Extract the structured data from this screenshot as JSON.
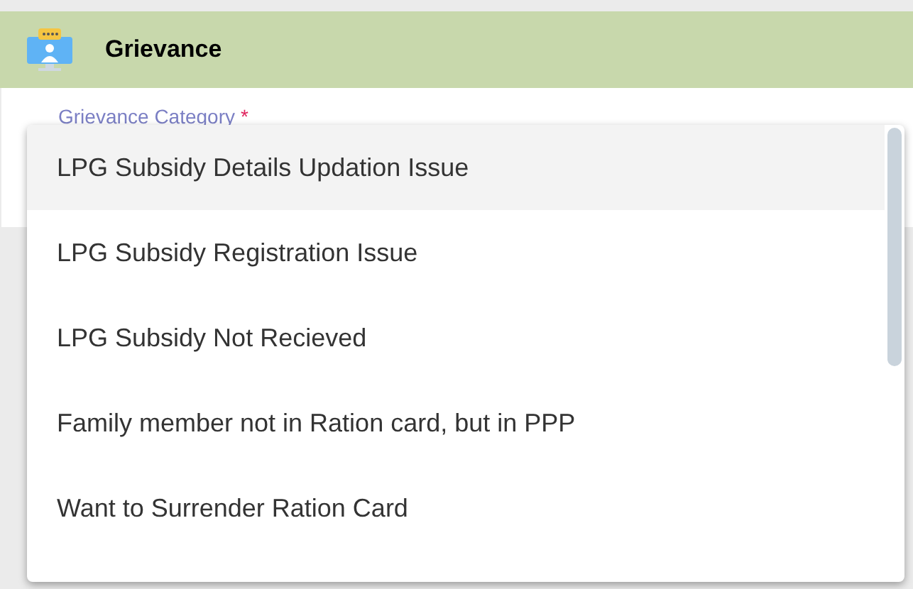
{
  "header": {
    "title": "Grievance"
  },
  "field": {
    "label": "Grievance Category",
    "required_mark": "*"
  },
  "dropdown": {
    "options": [
      {
        "label": "LPG Subsidy Details Updation Issue",
        "selected": true
      },
      {
        "label": "LPG Subsidy Registration Issue",
        "selected": false
      },
      {
        "label": "LPG Subsidy Not Recieved",
        "selected": false
      },
      {
        "label": "Family member not in Ration card, but in PPP",
        "selected": false
      },
      {
        "label": "Want to Surrender Ration Card",
        "selected": false
      }
    ]
  }
}
